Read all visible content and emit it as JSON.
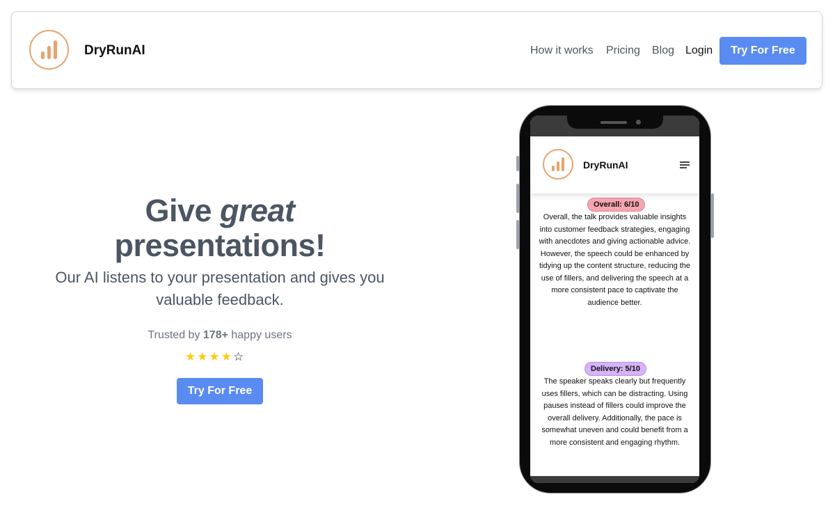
{
  "brand": {
    "name": "DryRunAI",
    "logo_icon": "bar-chart-icon",
    "logo_color": "#e8a36b"
  },
  "nav": {
    "links": [
      "How it works",
      "Pricing",
      "Blog"
    ],
    "login": "Login",
    "cta": "Try For Free"
  },
  "hero": {
    "title_before": "Give ",
    "title_emphasis": "great",
    "title_after": "presentations!",
    "subtitle": "Our AI listens to your presentation and gives you valuable feedback.",
    "trusted_prefix": "Trusted by ",
    "trusted_count": "178+",
    "trusted_suffix": " happy users",
    "rating": 4,
    "rating_max": 5,
    "cta": "Try For Free"
  },
  "phone": {
    "brand": "DryRunAI",
    "menu_icon": "hamburger-menu-icon",
    "feedback": [
      {
        "label": "Overall: 6/10",
        "color": "#f4a6b0",
        "text": "Overall, the talk provides valuable insights into customer feedback strategies, engaging with anecdotes and giving actionable advice. However, the speech could be enhanced by tidying up the content structure, reducing the use of fillers, and delivering the speech at a more consistent pace to captivate the audience better."
      },
      {
        "label": "Delivery: 5/10",
        "color": "#d6b4f7",
        "text": "The speaker speaks clearly but frequently uses fillers, which can be distracting. Using pauses instead of fillers could improve the overall delivery. Additionally, the pace is somewhat uneven and could benefit from a more consistent and engaging rhythm."
      }
    ]
  },
  "colors": {
    "primary": "#5a8bf0",
    "text": "#4b5563",
    "star": "#facc15"
  }
}
